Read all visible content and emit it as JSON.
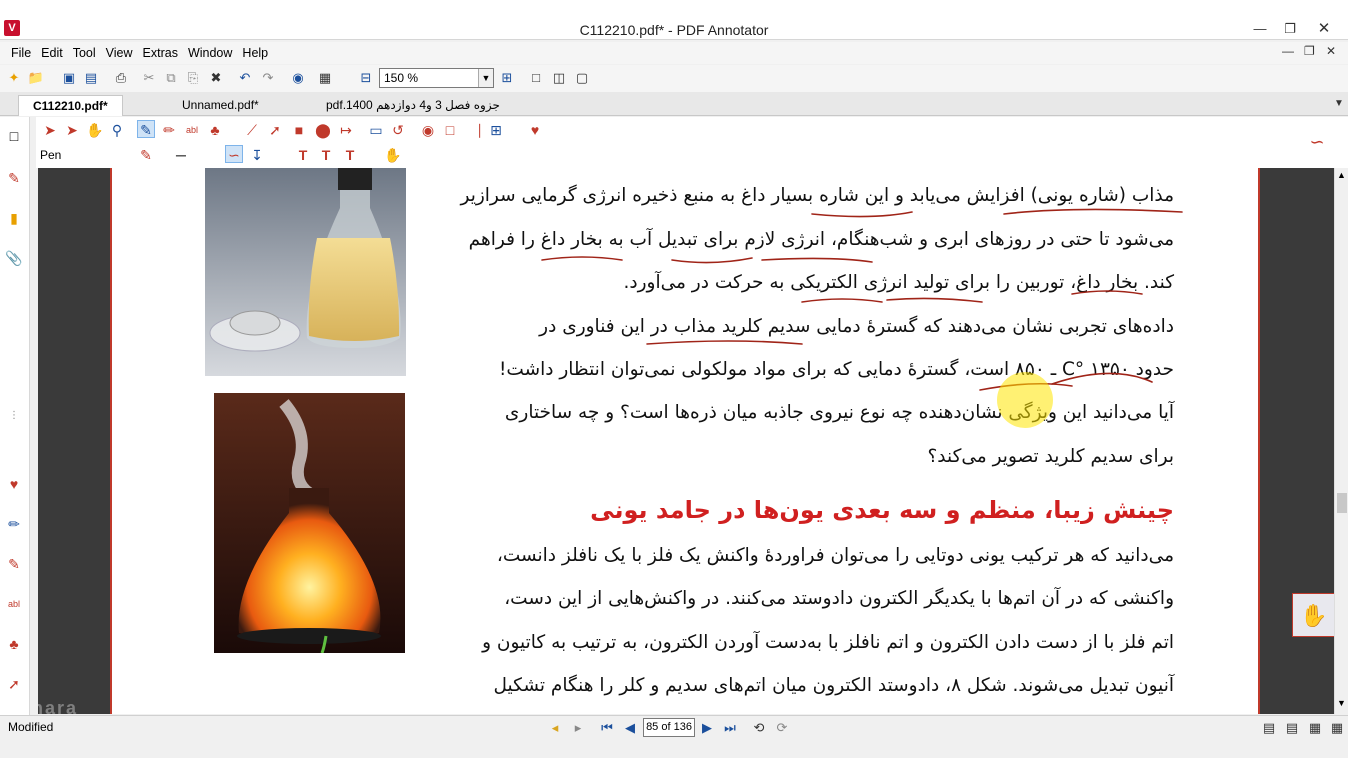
{
  "window": {
    "title": "C112210.pdf* - PDF Annotator",
    "app_icon": "pdf-annotator-logo"
  },
  "menu": [
    "File",
    "Edit",
    "Tool",
    "View",
    "Extras",
    "Window",
    "Help"
  ],
  "toolbar": {
    "zoom_value": "150 %"
  },
  "tabs": [
    {
      "label": "C112210.pdf*",
      "active": true
    },
    {
      "label": "Unnamed.pdf*",
      "active": false
    },
    {
      "label": "جزوه فصل 3 و4 دوازدهم 1400.pdf",
      "active": false
    }
  ],
  "annotation_bar": {
    "tool_label": "Pen"
  },
  "document": {
    "lines": [
      "مذاب (شاره یونی) افزایش می‌یابد و این شاره بسیار داغ به منبع ذخیره انرژی گرمایی سرازیر",
      "می‌شود تا حتی در روزهای ابری و شب‌هنگام، انرژی لازم برای تبدیل آب به بخار داغ را فراهم",
      "کند. بخار داغ، توربین را برای تولید انرژی الکتریکی به حرکت در می‌آورد.",
      "داده‌های تجربی نشان می‌دهند که گسترهٔ دمایی سدیم کلرید مذاب در این فناوری در",
      "حدود C° ۱۳۵۰ ـ ۸۵۰ است، گسترهٔ دمایی که برای مواد مولکولی نمی‌توان انتظار داشت!",
      "آیا می‌دانید این ویژگی نشان‌دهنده چه نوع نیروی جاذبه میان ذره‌ها است؟ و چه ساختاری",
      "برای سدیم کلرید تصویر می‌کند؟"
    ],
    "heading": "چینش زیبا، منظم و سه بعدی یون‌ها در جامد یونی",
    "lines2": [
      "می‌دانید که هر ترکیب یونی دوتایی را می‌توان فراوردهٔ واکنش یک فلز با یک نافلز دانست،",
      "واکنشی که در آن اتم‌ها با یکدیگر الکترون دادوستد می‌کنند. در واکنش‌هایی از این دست،",
      "اتم فلز با از دست دادن الکترون و اتم نافلز با به‌دست آوردن الکترون، به ترتیب به کاتیون و",
      "آنیون تبدیل می‌شوند. شکل ۸، دادوستد الکترون میان اتم‌های سدیم و کلر را هنگام تشکیل"
    ]
  },
  "status": {
    "label": "Modified",
    "page_indicator": "85 of 136"
  },
  "colors": {
    "annotation_red": "#c0392b",
    "heading_red": "#d02020",
    "highlight_yellow": "#ffe600",
    "page_border": "#c0392b"
  }
}
